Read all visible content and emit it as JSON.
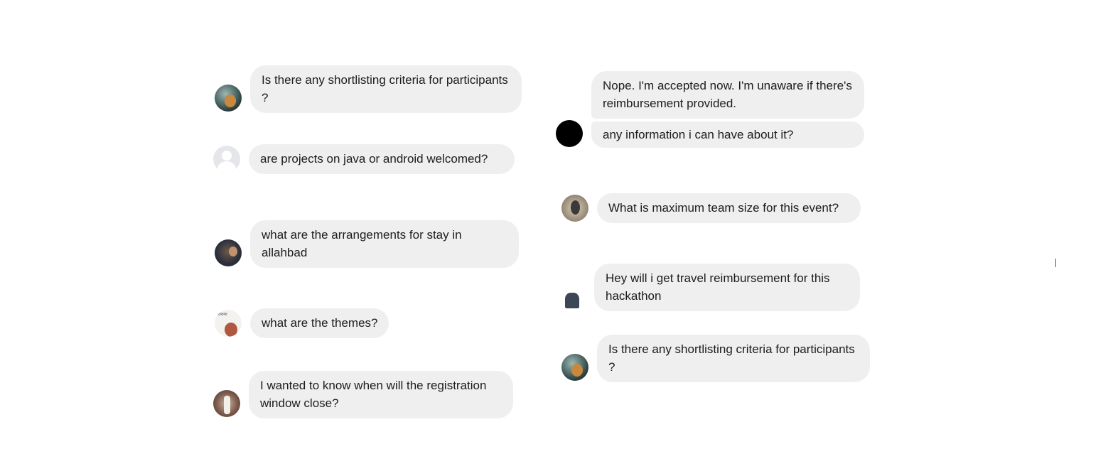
{
  "messages_left": [
    {
      "lines": [
        "Is there any shortlisting criteria for participants ?"
      ]
    },
    {
      "lines": [
        "are projects on java or android welcomed?"
      ]
    },
    {
      "lines": [
        "what are the arrangements for stay in allahbad"
      ]
    },
    {
      "lines": [
        "what are the themes?"
      ]
    },
    {
      "lines": [
        "I wanted to know when will the registration window close?"
      ]
    }
  ],
  "messages_right": [
    {
      "lines": [
        "Nope. I'm accepted now. I'm unaware if there's reimbursement provided.",
        "any information i can have about it?"
      ]
    },
    {
      "lines": [
        "What is maximum team size for this event?"
      ]
    },
    {
      "lines": [
        "Hey will i get travel reimbursement for this hackathon"
      ]
    },
    {
      "lines": [
        "Is there any shortlisting criteria for participants ?"
      ]
    }
  ]
}
